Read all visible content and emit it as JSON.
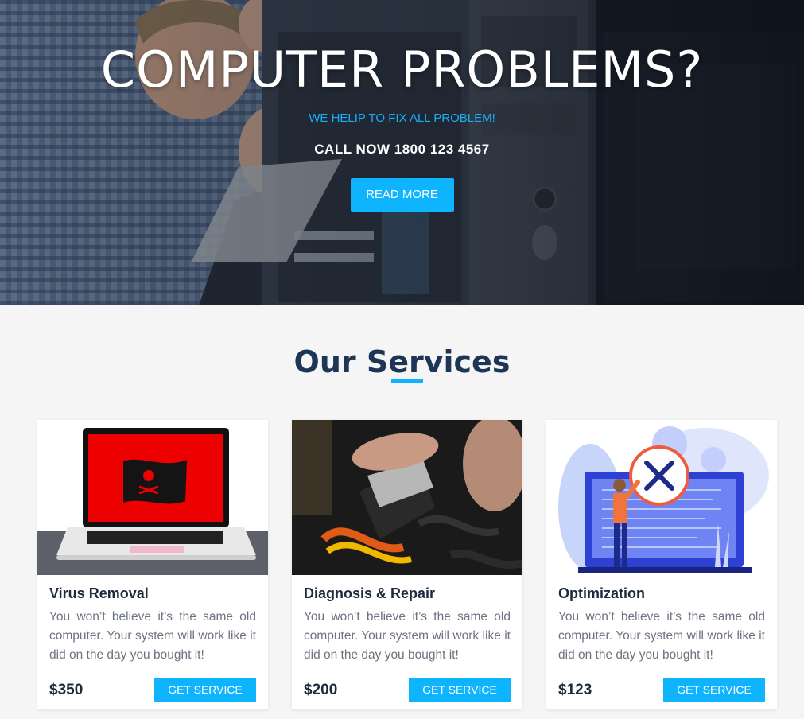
{
  "hero": {
    "title": "COMPUTER PROBLEMS?",
    "subtitle": "WE HELIP TO FIX ALL PROBLEM!",
    "call": "CALL NOW 1800 123 4567",
    "button_label": "READ MORE"
  },
  "services": {
    "title": "Our Services",
    "cards": [
      {
        "name": "Virus Removal",
        "description": "You won’t believe it’s the same old computer. Your system will work like it did on the day you bought it!",
        "price": "$350",
        "button_label": "GET SERVICE",
        "image_icon": "hacked-laptop-image"
      },
      {
        "name": "Diagnosis & Repair",
        "description": "You won’t believe it’s the same old computer. Your system will work like it did on the day you bought it!",
        "price": "$200",
        "button_label": "GET SERVICE",
        "image_icon": "hard-drive-repair-image"
      },
      {
        "name": "Optimization",
        "description": "You won’t believe it’s the same old computer. Your system will work like it did on the day you bought it!",
        "price": "$123",
        "button_label": "GET SERVICE",
        "image_icon": "optimization-illustration-image"
      }
    ]
  },
  "colors": {
    "accent": "#0fb4ff",
    "heading": "#1d3557",
    "text": "#6c7380"
  }
}
